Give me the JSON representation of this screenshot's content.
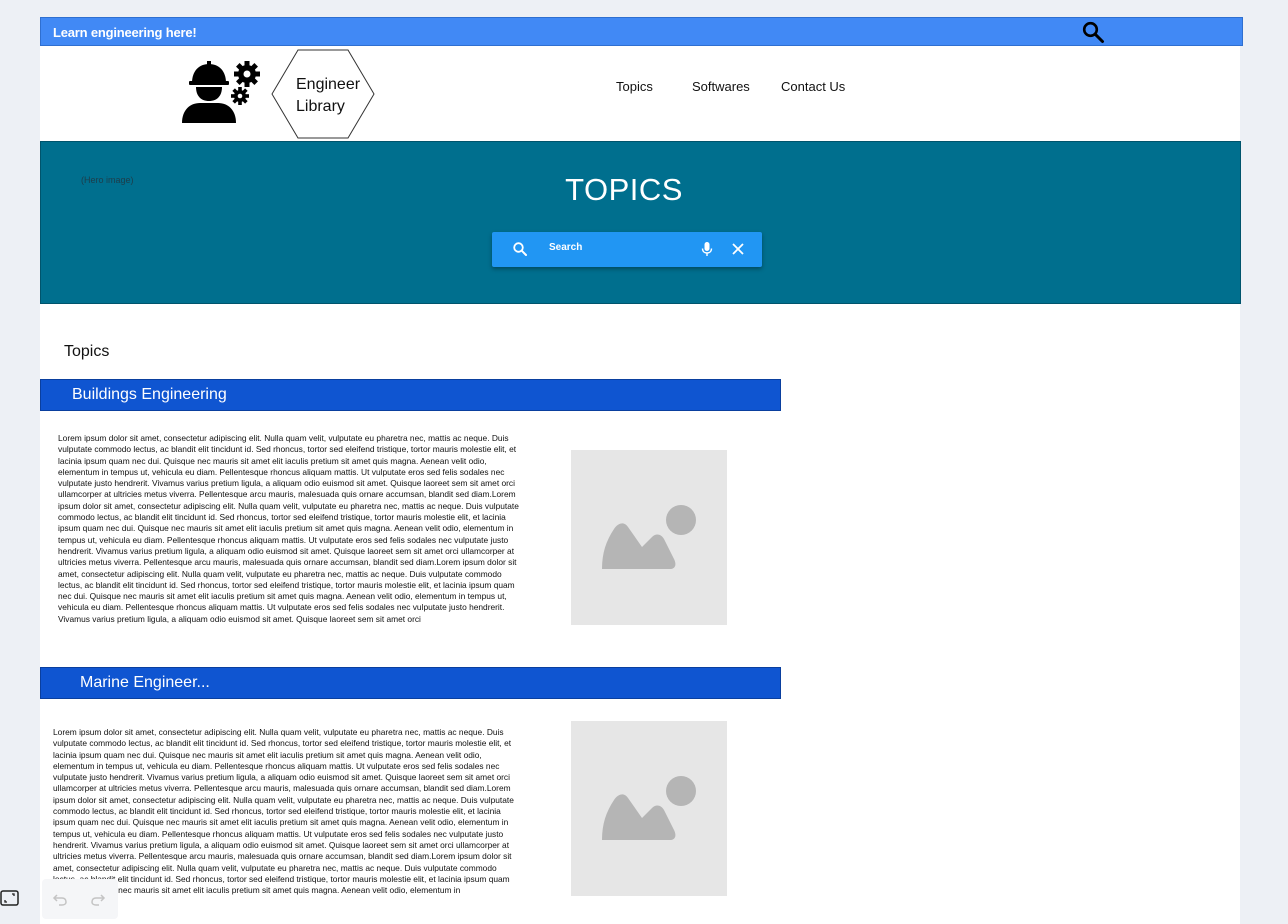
{
  "topbar": {
    "text": "Learn engineering here!",
    "search_icon": "search-icon"
  },
  "header": {
    "logo_icon": "engineer-gears-icon",
    "logo_line1": "Engineer",
    "logo_line2": "Library",
    "nav": [
      "Topics",
      "Softwares",
      "Contact Us"
    ]
  },
  "hero": {
    "caption": "(Hero image)",
    "title": "TOPICS",
    "search_placeholder": "Search",
    "icons": [
      "search-icon",
      "mic-icon",
      "close-icon"
    ]
  },
  "topics": {
    "heading": "Topics",
    "categories": [
      {
        "label": "Buildings Engineering",
        "text": "Lorem ipsum dolor sit amet, consectetur adipiscing elit. Nulla quam velit, vulputate eu pharetra nec, mattis ac neque. Duis vulputate commodo lectus, ac blandit elit tincidunt id. Sed rhoncus, tortor sed eleifend tristique, tortor mauris molestie elit, et lacinia ipsum quam nec dui. Quisque nec mauris sit amet elit iaculis pretium sit amet quis magna. Aenean velit odio, elementum in tempus ut, vehicula eu diam. Pellentesque rhoncus aliquam mattis. Ut vulputate eros sed felis sodales nec vulputate justo hendrerit. Vivamus varius pretium ligula, a aliquam odio euismod sit amet. Quisque laoreet sem sit amet orci ullamcorper at ultricies metus viverra. Pellentesque arcu mauris, malesuada quis ornare accumsan, blandit sed diam.Lorem ipsum dolor sit amet, consectetur adipiscing elit. Nulla quam velit, vulputate eu pharetra nec, mattis ac neque. Duis vulputate commodo lectus, ac blandit elit tincidunt id. Sed rhoncus, tortor sed eleifend tristique, tortor mauris molestie elit, et lacinia ipsum quam nec dui. Quisque nec mauris sit amet elit iaculis pretium sit amet quis magna. Aenean velit odio, elementum in tempus ut, vehicula eu diam. Pellentesque rhoncus aliquam mattis. Ut vulputate eros sed felis sodales nec vulputate justo hendrerit. Vivamus varius pretium ligula, a aliquam odio euismod sit amet. Quisque laoreet sem sit amet orci ullamcorper at ultricies metus viverra. Pellentesque arcu mauris, malesuada quis ornare accumsan, blandit sed diam.Lorem ipsum dolor sit amet, consectetur adipiscing elit. Nulla quam velit, vulputate eu pharetra nec, mattis ac neque. Duis vulputate commodo lectus, ac blandit elit tincidunt id. Sed rhoncus, tortor sed eleifend tristique, tortor mauris molestie elit, et lacinia ipsum quam nec dui. Quisque nec mauris sit amet elit iaculis pretium sit amet quis magna. Aenean velit odio, elementum in tempus ut, vehicula eu diam. Pellentesque rhoncus aliquam mattis. Ut vulputate eros sed felis sodales nec vulputate justo hendrerit. Vivamus varius pretium ligula, a aliquam odio euismod sit amet. Quisque laoreet sem sit amet orci"
      },
      {
        "label": "Marine Engineer...",
        "text": "Lorem ipsum dolor sit amet, consectetur adipiscing elit. Nulla quam velit, vulputate eu pharetra nec, mattis ac neque. Duis vulputate commodo lectus, ac blandit elit tincidunt id. Sed rhoncus, tortor sed eleifend tristique, tortor mauris molestie elit, et lacinia ipsum quam nec dui. Quisque nec mauris sit amet elit iaculis pretium sit amet quis magna. Aenean velit odio, elementum in tempus ut, vehicula eu diam. Pellentesque rhoncus aliquam mattis. Ut vulputate eros sed felis sodales nec vulputate justo hendrerit. Vivamus varius pretium ligula, a aliquam odio euismod sit amet. Quisque laoreet sem sit amet orci ullamcorper at ultricies metus viverra. Pellentesque arcu mauris, malesuada quis ornare accumsan, blandit sed diam.Lorem ipsum dolor sit amet, consectetur adipiscing elit. Nulla quam velit, vulputate eu pharetra nec, mattis ac neque. Duis vulputate commodo lectus, ac blandit elit tincidunt id. Sed rhoncus, tortor sed eleifend tristique, tortor mauris molestie elit, et lacinia ipsum quam nec dui. Quisque nec mauris sit amet elit iaculis pretium sit amet quis magna. Aenean velit odio, elementum in tempus ut, vehicula eu diam. Pellentesque rhoncus aliquam mattis. Ut vulputate eros sed felis sodales nec vulputate justo hendrerit. Vivamus varius pretium ligula, a aliquam odio euismod sit amet. Quisque laoreet sem sit amet orci ullamcorper at ultricies metus viverra. Pellentesque arcu mauris, malesuada quis ornare accumsan, blandit sed diam.Lorem ipsum dolor sit amet, consectetur adipiscing elit. Nulla quam velit, vulputate eu pharetra nec, mattis ac neque. Duis vulputate commodo lectus, ac blandit elit tincidunt id. Sed rhoncus, tortor sed eleifend tristique, tortor mauris molestie elit, et lacinia ipsum quam nec dui. Quisque nec mauris sit amet elit iaculis pretium sit amet quis magna. Aenean velit odio, elementum in"
      }
    ],
    "image_icon": "image-placeholder-icon"
  },
  "controls": {
    "icons": [
      "expand-icon",
      "undo-icon",
      "redo-icon"
    ]
  },
  "colors": {
    "topbar": "#4189f5",
    "hero": "#006f8e",
    "category_bar": "#0f55d1",
    "searchbar": "#2196f3"
  }
}
